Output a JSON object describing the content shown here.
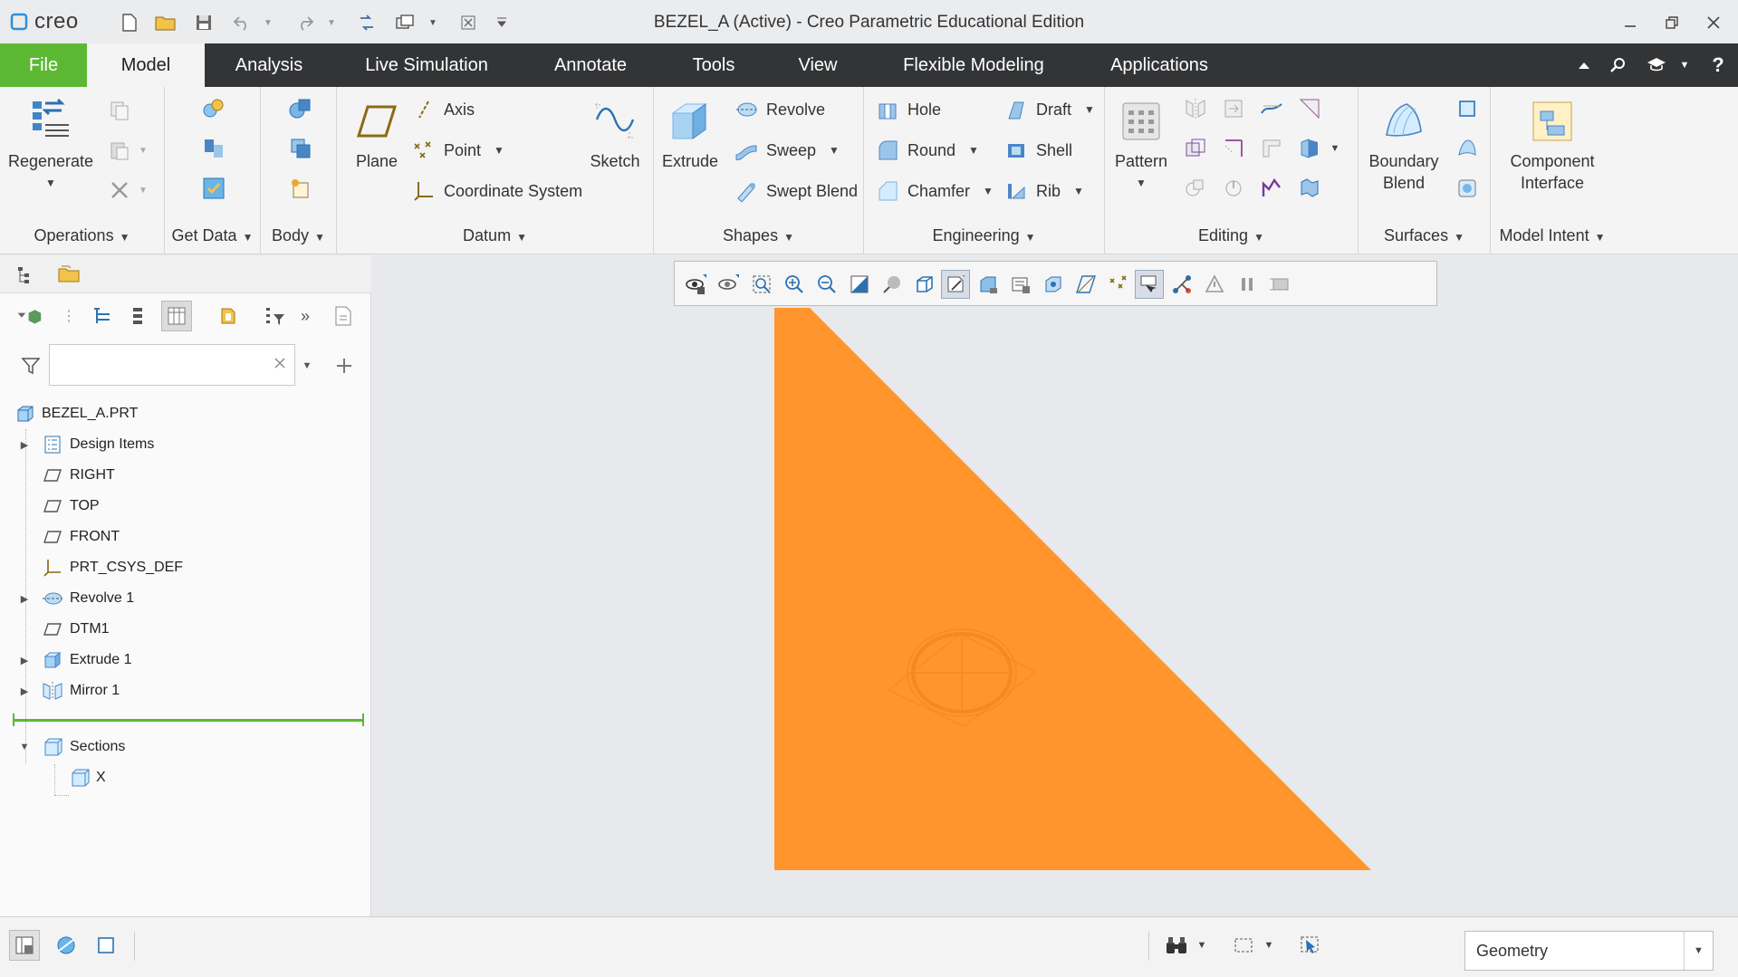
{
  "titlebar": {
    "logo_text": "creo",
    "window_title": "BEZEL_A (Active) - Creo Parametric Educational Edition"
  },
  "tabs": [
    {
      "label": "File"
    },
    {
      "label": "Model"
    },
    {
      "label": "Analysis"
    },
    {
      "label": "Live Simulation"
    },
    {
      "label": "Annotate"
    },
    {
      "label": "Tools"
    },
    {
      "label": "View"
    },
    {
      "label": "Flexible Modeling"
    },
    {
      "label": "Applications"
    }
  ],
  "ribbon": {
    "operations": {
      "label": "Operations",
      "regenerate": "Regenerate"
    },
    "get_data": {
      "label": "Get Data"
    },
    "body": {
      "label": "Body"
    },
    "datum": {
      "label": "Datum",
      "plane": "Plane",
      "axis": "Axis",
      "point": "Point",
      "csys": "Coordinate System",
      "sketch": "Sketch"
    },
    "shapes": {
      "label": "Shapes",
      "extrude": "Extrude",
      "revolve": "Revolve",
      "sweep": "Sweep",
      "swept_blend": "Swept Blend"
    },
    "engineering": {
      "label": "Engineering",
      "hole": "Hole",
      "round": "Round",
      "chamfer": "Chamfer",
      "draft": "Draft",
      "shell": "Shell",
      "rib": "Rib"
    },
    "editing": {
      "label": "Editing",
      "pattern": "Pattern"
    },
    "surfaces": {
      "label": "Surfaces",
      "boundary_blend_1": "Boundary",
      "boundary_blend_2": "Blend"
    },
    "model_intent": {
      "label": "Model Intent",
      "component_interface_1": "Component",
      "component_interface_2": "Interface"
    }
  },
  "tree": {
    "root": "BEZEL_A.PRT",
    "items": [
      {
        "label": "Design Items"
      },
      {
        "label": "RIGHT"
      },
      {
        "label": "TOP"
      },
      {
        "label": "FRONT"
      },
      {
        "label": "PRT_CSYS_DEF"
      },
      {
        "label": "Revolve 1"
      },
      {
        "label": "DTM1"
      },
      {
        "label": "Extrude 1"
      },
      {
        "label": "Mirror 1"
      }
    ],
    "sections": "Sections",
    "section_items": [
      {
        "label": "X"
      }
    ],
    "search_value": ""
  },
  "statusbar": {
    "filter_value": "Geometry"
  },
  "colors": {
    "file_tab": "#5cb833",
    "tab_bar": "#333436",
    "model_fill": "#ff952c",
    "insert_line": "#5cb833"
  }
}
